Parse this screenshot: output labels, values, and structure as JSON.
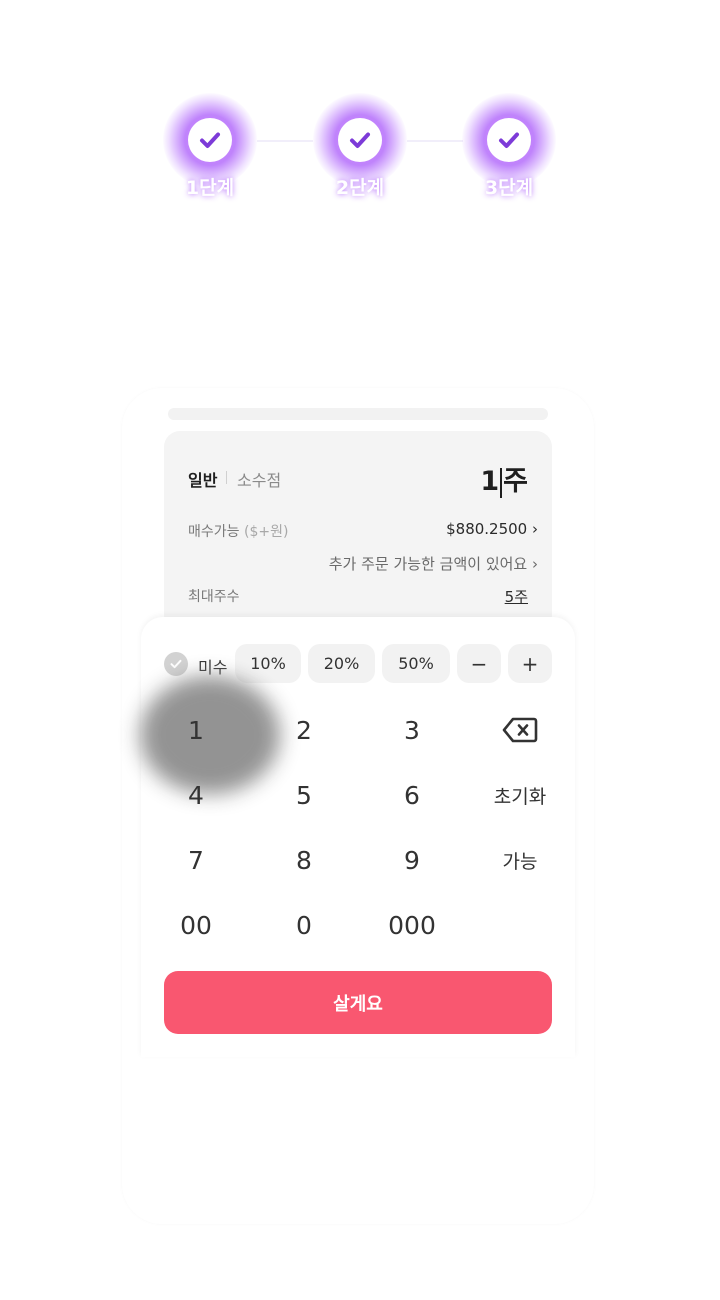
{
  "steps": [
    {
      "label": "1단계"
    },
    {
      "label": "2단계"
    },
    {
      "label": "3단계"
    }
  ],
  "order": {
    "tabs": {
      "normal": "일반",
      "decimal": "소수점"
    },
    "quantity": {
      "digit": "1",
      "unit": "주"
    },
    "buy_power": {
      "label": "매수가능",
      "sub": "($+원)",
      "value": "$880.2500 ›"
    },
    "extra_note": "추가 주문 가능한 금액이 있어요 ›",
    "max_shares": {
      "label": "최대주수",
      "value": "5주"
    }
  },
  "quick": {
    "misu": "미수",
    "chips": [
      "10%",
      "20%",
      "50%",
      "−",
      "+"
    ]
  },
  "keypad": {
    "k1": "1",
    "k2": "2",
    "k3": "3",
    "k4": "4",
    "k5": "5",
    "k6": "6",
    "reset": "초기화",
    "k7": "7",
    "k8": "8",
    "k9": "9",
    "possible": "가능",
    "k00": "00",
    "k0": "0",
    "k000": "000"
  },
  "buy_button": "살게요",
  "colors": {
    "accent": "#f95770",
    "step_glow": "#b45cff",
    "check": "#7d3bd8"
  }
}
